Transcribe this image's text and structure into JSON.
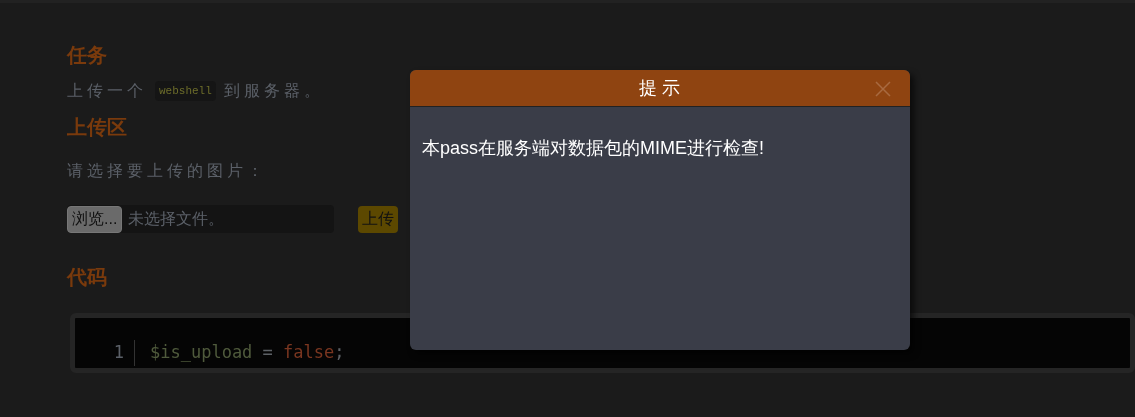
{
  "task": {
    "heading": "任务",
    "text_before": "上传一个",
    "code": "webshell",
    "text_after": "到服务器。"
  },
  "upload": {
    "heading": "上传区",
    "prompt": "请选择要上传的图片：",
    "browse_button": "浏览...",
    "file_status": "未选择文件。",
    "submit_button": "上传"
  },
  "code": {
    "heading": "代码",
    "lines": [
      {
        "number": "1",
        "tokens": [
          {
            "kind": "variable",
            "text": "$is_upload"
          },
          {
            "kind": "plain",
            "text": " = "
          },
          {
            "kind": "keyword",
            "text": "false"
          },
          {
            "kind": "plain",
            "text": ";"
          }
        ]
      }
    ]
  },
  "dialog": {
    "title": "提 示",
    "message": "本pass在服务端对数据包的MIME进行检查!"
  }
}
